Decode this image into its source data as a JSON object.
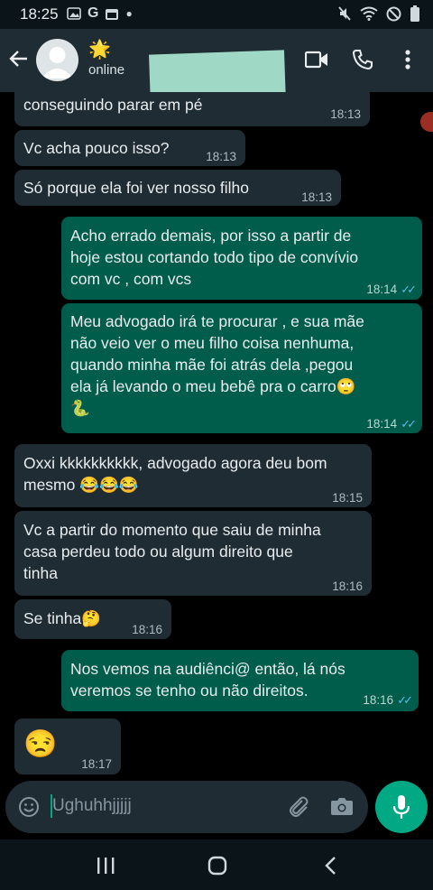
{
  "status_bar": {
    "time": "18:25",
    "left_icons": [
      "image-icon",
      "google-icon",
      "calendar-icon",
      "dot-icon"
    ],
    "right_icons": [
      "mute-icon",
      "wifi-icon",
      "no-signal-icon",
      "battery-icon"
    ]
  },
  "header": {
    "status": "online",
    "star": "🌟"
  },
  "messages": [
    {
      "dir": "in",
      "text": "conseguindo parar em pé",
      "time": "18:13"
    },
    {
      "dir": "in",
      "text": "Vc acha pouco isso?",
      "time": "18:13"
    },
    {
      "dir": "in",
      "text": "Só porque ela foi ver nosso filho",
      "time": "18:13"
    },
    {
      "dir": "out",
      "text": "Acho errado demais,  por isso a partir de\nhoje estou cortando todo tipo de convívio\ncom vc , com vcs",
      "time": "18:14"
    },
    {
      "dir": "out",
      "text": "Meu advogado irá te procurar , e sua mãe\nnão veio ver o meu filho coisa nenhuma,\nquando minha mãe foi atrás dela ,pegou\nela já levando o meu bebê pra o carro🙄\n🐍",
      "time": "18:14"
    },
    {
      "dir": "in",
      "text": "Oxxi kkkkkkkkkk, advogado agora deu bom\nmesmo 😂😂😂",
      "time": "18:15"
    },
    {
      "dir": "in",
      "text": "Vc a partir do momento que saiu de minha\ncasa perdeu todo ou algum direito que\ntinha",
      "time": "18:16"
    },
    {
      "dir": "in",
      "text": "Se tinha🤔",
      "time": "18:16"
    },
    {
      "dir": "out",
      "text": "Nos vemos na audiênci@ então,  lá nós\nveremos se tenho ou não direitos.",
      "time": "18:16"
    },
    {
      "dir": "in",
      "text": "😒",
      "time": "18:17"
    }
  ],
  "composer": {
    "value": "Ughuhhjjjjj"
  },
  "colors": {
    "incoming": "#1f2c33",
    "outgoing": "#005c4b",
    "accent": "#00a884",
    "read_ticks": "#53bdeb"
  }
}
